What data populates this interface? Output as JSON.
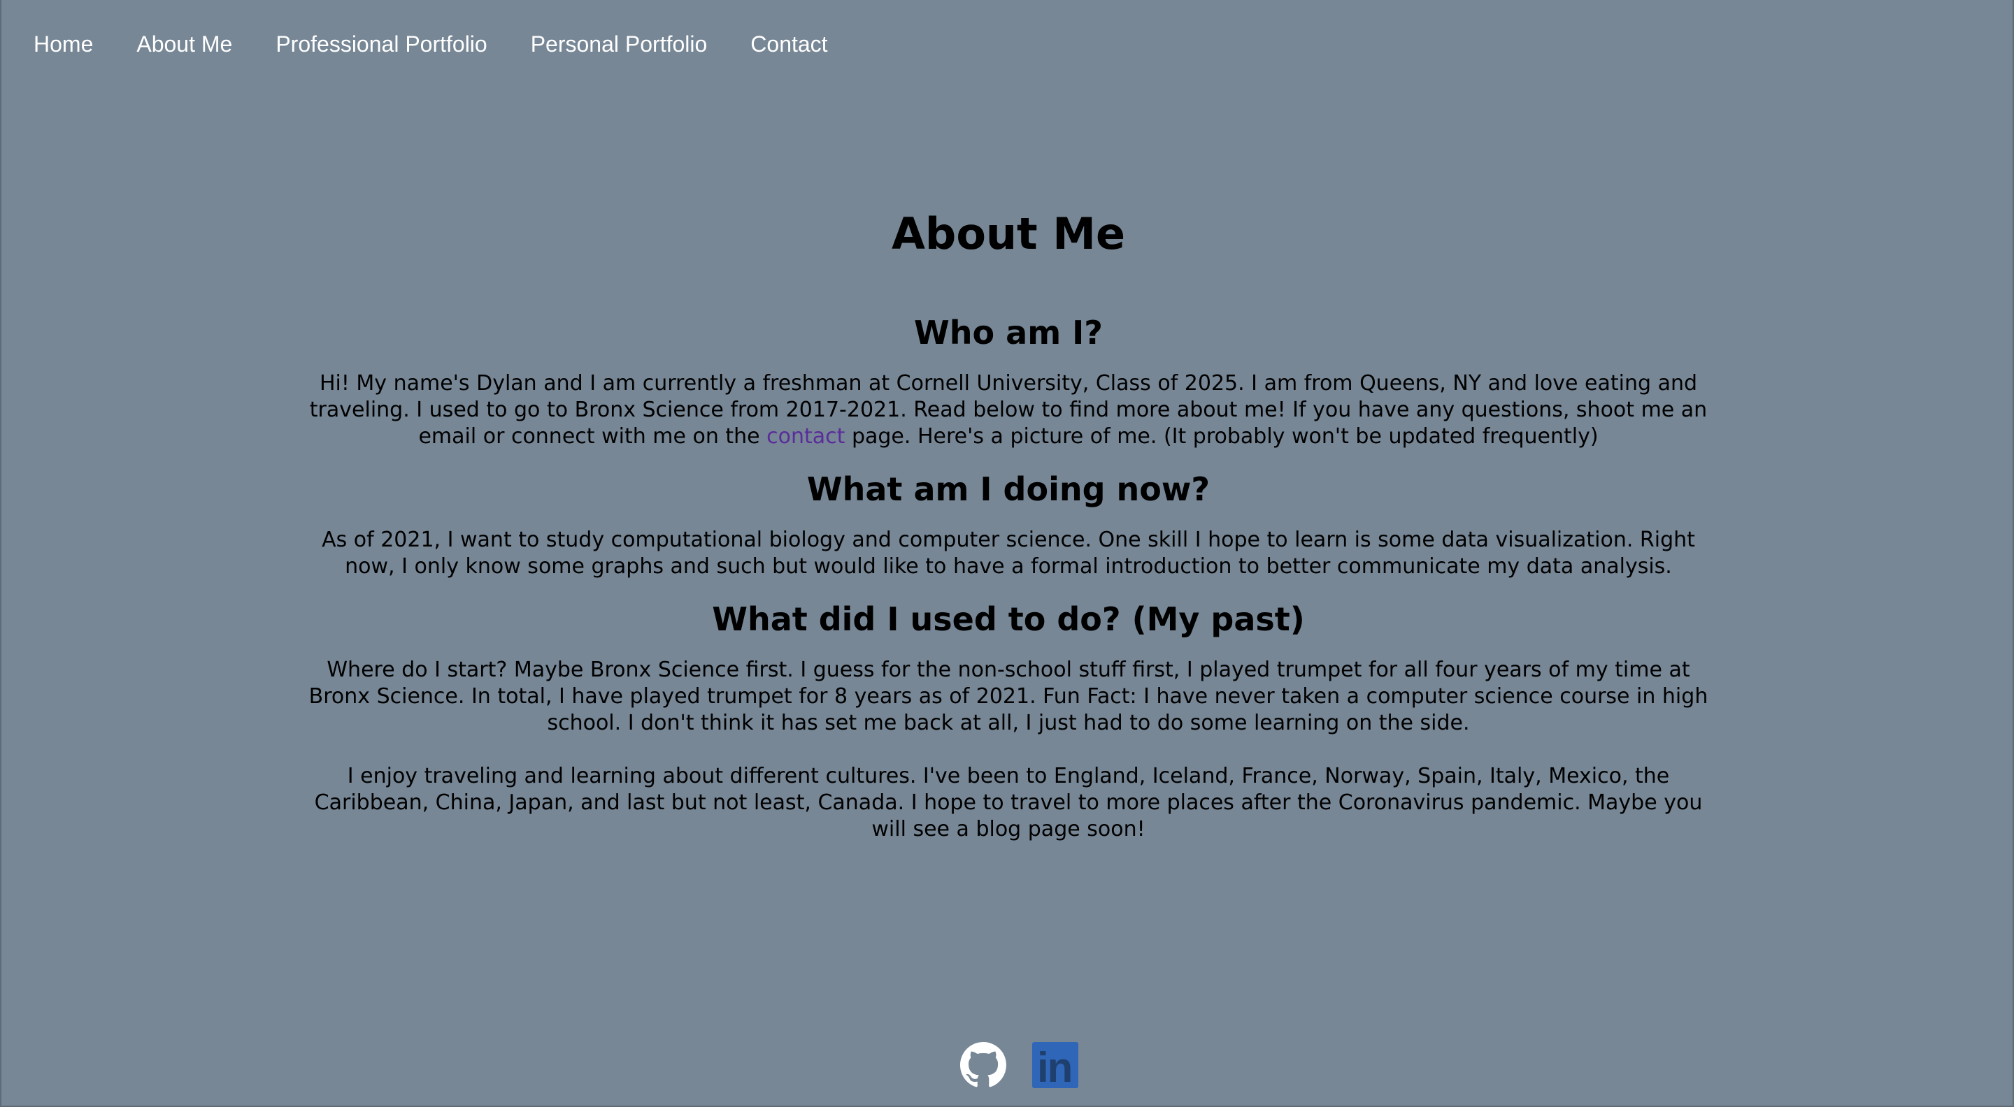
{
  "nav": {
    "items": [
      "Home",
      "About Me",
      "Professional Portfolio",
      "Personal Portfolio",
      "Contact"
    ]
  },
  "page": {
    "title": "About Me"
  },
  "sections": {
    "who": {
      "heading": "Who am I?",
      "text_before_link": "Hi! My name's Dylan and I am currently a freshman at Cornell University, Class of 2025. I am from Queens, NY and love eating and traveling. I used to go to Bronx Science from 2017-2021. Read below to find more about me! If you have any questions, shoot me an email or connect with me on the ",
      "link_text": "contact",
      "text_after_link": " page. Here's a picture of me. (It probably won't be updated frequently)"
    },
    "now": {
      "heading": "What am I doing now?",
      "text": "As of 2021, I want to study computational biology and computer science. One skill I hope to learn is some data visualization. Right now, I only know some graphs and such but would like to have a formal introduction to better communicate my data analysis."
    },
    "past": {
      "heading": "What did I used to do? (My past)",
      "paragraphs": [
        "Where do I start? Maybe Bronx Science first. I guess for the non-school stuff first, I played trumpet for all four years of my time at Bronx Science. In total, I have played trumpet for 8 years as of 2021. Fun Fact: I have never taken a computer science course in high school. I don't think it has set me back at all, I just had to do some learning on the side.",
        "I enjoy traveling and learning about different cultures. I've been to England, Iceland, France, Norway, Spain, Italy, Mexico, the Caribbean, China, Japan, and last but not least, Canada. I hope to travel to more places after the Coronavirus pandemic. Maybe you will see a blog page soon!"
      ]
    }
  },
  "footer": {
    "icons": [
      "github-icon",
      "linkedin-icon"
    ],
    "linkedin_glyph": "in"
  },
  "colors": {
    "background": "#778796",
    "nav_text": "#ffffff",
    "link": "#5a2d9a",
    "linkedin": "#2f66b8"
  }
}
